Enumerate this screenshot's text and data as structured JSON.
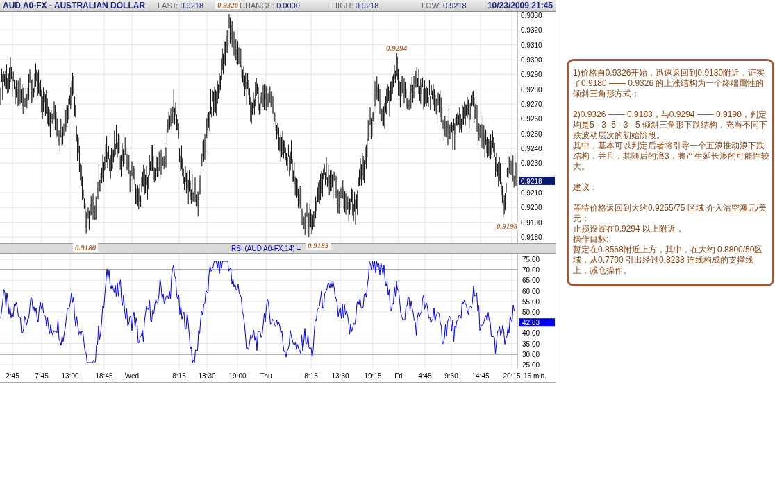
{
  "header": {
    "title": "AUD A0-FX - AUSTRALIAN DOLLAR",
    "stats": [
      {
        "label": "LAST:",
        "value": "0.9218"
      },
      {
        "label": "CHANGE:",
        "value": "0.0000"
      },
      {
        "label": "HIGH:",
        "value": "0.9218"
      },
      {
        "label": "LOW:",
        "value": "0.9218"
      }
    ],
    "datetime": "10/23/2009 21:45"
  },
  "price_panel": {
    "y_ticks": [
      "0.9330",
      "0.9320",
      "0.9310",
      "0.9300",
      "0.9290",
      "0.9280",
      "0.9270",
      "0.9260",
      "0.9250",
      "0.9240",
      "0.9230",
      "0.9210",
      "0.9200",
      "0.9190",
      "0.9180"
    ],
    "current": "0.9218"
  },
  "annotations": [
    "0.9326",
    "0.9294",
    "0.9198",
    "0.9180",
    "0.9183"
  ],
  "rsi_panel": {
    "title": "RSI (AUD A0-FX,14) =",
    "y_ticks": [
      "75.00",
      "70.00",
      "65.00",
      "60.00",
      "55.00",
      "50.00",
      "40.00",
      "35.00",
      "30.00",
      "25.00"
    ],
    "current": "42.83"
  },
  "x_axis": {
    "labels": [
      "2:45",
      "7:45",
      "13:00",
      "18:45",
      "Wed",
      "8:15",
      "13:30",
      "19:00",
      "Thu",
      "8:15",
      "13:30",
      "19:15",
      "Fri",
      "4:45",
      "9:30",
      "14:45",
      "20:15"
    ],
    "interval": "15 min."
  },
  "note": {
    "blocks": [
      [
        "1)价格自0.9326开始，迅速返回到0.9180附近，证实了0.9180 —— 0.9326 的上涨结构为一个终端属性的倾斜三角形方式；"
      ],
      [
        "2)0.9326 —— 0.9183，与0.9294 —— 0.9198，判定均是5 - 3 -5 - 3 - 5 倾斜三角形下跌结构，充当不同下跌波动层次的初始阶段。",
        "其中，基本可以判定后者将引导一个五浪推动浪下跌结构，并且，其随后的浪3，将产生延长浪的可能性较大。"
      ],
      [
        "建议："
      ],
      [
        "等待价格返回到大约0.9255/75 区域 介入沽空澳元/美元；",
        "止损设置在0.9294 以上附近，",
        "操作目标:",
        "暂定在0.8568附近上方，其中，在大约 0.8800/50区域，从0.7700 引出经过0.8238 连线构成的支撑线上，减仓操作。"
      ]
    ]
  }
}
